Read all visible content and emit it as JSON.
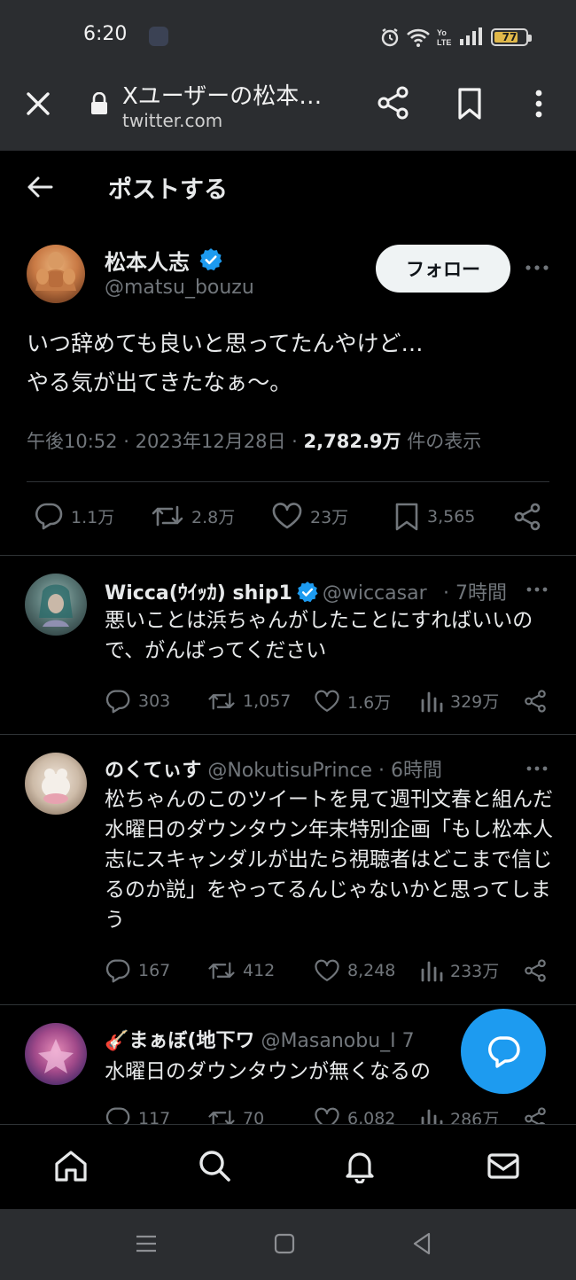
{
  "status_bar": {
    "time": "6:20",
    "battery": "77",
    "battery_level": 0.77
  },
  "browser": {
    "title": "Xユーザーの松本…",
    "url": "twitter.com"
  },
  "header": {
    "title": "ポストする"
  },
  "main_post": {
    "author_name": "松本人志",
    "author_handle": "@matsu_bouzu",
    "follow_label": "フォロー",
    "text_line1": "いつ辞めても良いと思ってたんやけど…",
    "text_line2": "やる気が出てきたなぁ〜。",
    "time": "午後10:52",
    "date": "2023年12月28日",
    "views": "2,782.9万",
    "views_suffix": "件の表示",
    "replies": "1.1万",
    "reposts": "2.8万",
    "likes": "23万",
    "bookmarks": "3,565"
  },
  "replies": [
    {
      "name": "Wicca(ｳｲｯｶ) ship1",
      "handle": "@wiccasar",
      "time": "7時間",
      "text": "悪いことは浜ちゃんがしたことにすればいいので、がんばってください",
      "replies": "303",
      "reposts": "1,057",
      "likes": "1.6万",
      "views": "329万"
    },
    {
      "name": "のくてぃす",
      "handle": "@NokutisuPrince",
      "time": "6時間",
      "text": "松ちゃんのこのツイートを見て週刊文春と組んだ水曜日のダウンタウン年末特別企画「もし松本人志にスキャンダルが出たら視聴者はどこまで信じるのか説」をやってるんじゃないかと思ってしまう",
      "replies": "167",
      "reposts": "412",
      "likes": "8,248",
      "views": "233万"
    },
    {
      "name": "🎸まぁぼ(地下ワ",
      "handle": "@Masanobu_I",
      "time": "7",
      "text": "水曜日のダウンタウンが無くなるの",
      "replies": "117",
      "reposts": "70",
      "likes": "6,082",
      "views": "286万"
    }
  ],
  "icons": {
    "verified": "verified-badge-icon",
    "accent": "#1d9bf0",
    "fab": "compose-reply-icon"
  }
}
